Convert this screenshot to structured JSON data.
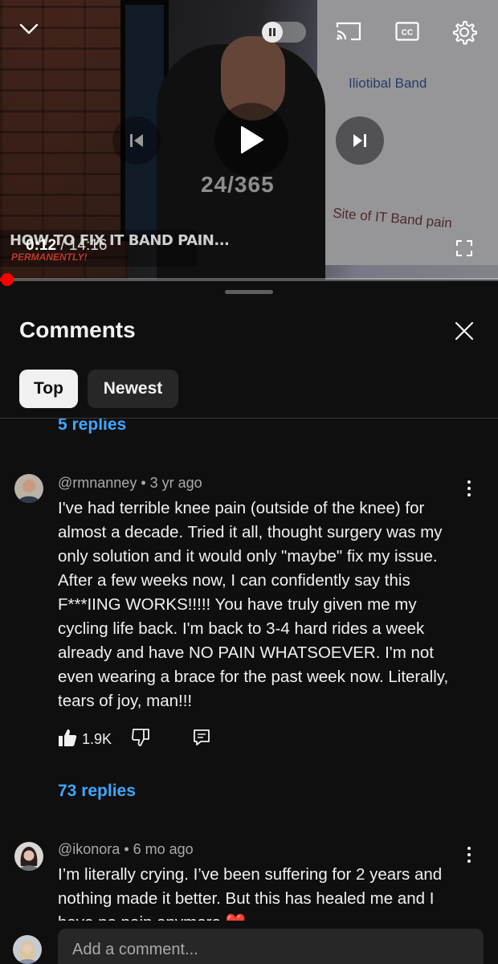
{
  "player": {
    "current_time": "0:12",
    "duration": "/ 14:16",
    "overlay_title": "HOW TO FIX IT BAND PAIN...",
    "overlay_subtitle": "PERMANENTLY!",
    "board_label_top": "Iliotibal Band",
    "board_label_bottom": "Site of IT Band pain",
    "shirt_text": "24/365",
    "progress_fraction": 0.014,
    "icons": [
      "chevron-down-icon",
      "pause-icon",
      "cast-icon",
      "closed-captions-icon",
      "settings-gear-icon",
      "previous-icon",
      "play-icon",
      "next-icon",
      "fullscreen-icon"
    ],
    "accent_color": "#ff0000"
  },
  "comments_panel": {
    "title": "Comments",
    "sort_chips": [
      {
        "label": "Top",
        "selected": true
      },
      {
        "label": "Newest",
        "selected": false
      }
    ]
  },
  "previous_thread": {
    "replies_label": "5 replies"
  },
  "comments": [
    {
      "author": "@rmnanney",
      "age": "3 yr ago",
      "text": "I've had terrible knee pain (outside of the knee) for almost a decade.  Tried it all, thought surgery was my only solution and it would only \"maybe\" fix my issue.  After a few weeks now, I can confidently say this F***IING WORKS!!!!!  You have truly given me my cycling life back.  I'm back to 3-4 hard rides a week already and have NO PAIN WHATSOEVER.  I'm not even wearing a brace for the past week now.  Literally, tears of joy, man!!!",
      "likes": "1.9K",
      "replies_label": "73 replies"
    },
    {
      "author": "@ikonora",
      "age": "6 mo ago",
      "text": "I’m literally crying. I’ve been suffering for 2 years and nothing made it better. But this has healed me and I have no pain anymore ❤️"
    }
  ],
  "add_comment": {
    "placeholder": "Add a comment..."
  },
  "colors": {
    "background": "#0f0f0f",
    "link_blue": "#3ea6ff",
    "chip_selected": "#f1f1f1",
    "chip_unselected": "#272727"
  }
}
